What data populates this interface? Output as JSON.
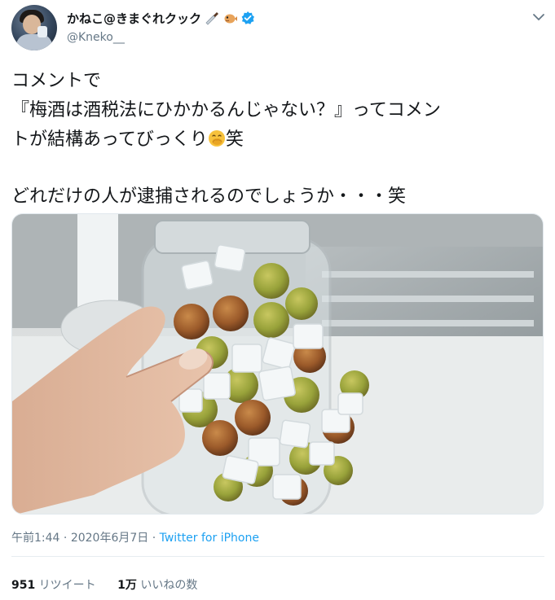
{
  "author": {
    "display_name": "かねこ@きまぐれクック",
    "handle": "@Kneko__",
    "name_emojis": [
      "kitchen-knife-icon",
      "blowfish-icon"
    ],
    "verified": true
  },
  "tweet": {
    "lines": [
      "コメントで",
      "『梅酒は酒税法にひかかるんじゃない？』ってコメン",
      "トが結構あってびっくり",
      "笑",
      "どれだけの人が逮捕されるのでしょうか・・・笑"
    ],
    "emoji": "face-with-hand-over-mouth-icon"
  },
  "photo": {
    "description_icon": "plum-wine-jar-photo"
  },
  "meta": {
    "time": "午前1:44",
    "separator": "·",
    "date": "2020年6月7日",
    "source": "Twitter for iPhone"
  },
  "stats": {
    "retweets_count": "951",
    "retweets_label": "リツイート",
    "likes_count": "1万",
    "likes_label": "いいねの数"
  },
  "colors": {
    "accent": "#1da1f2",
    "text": "#14171a",
    "secondary": "#657786",
    "border": "#e6ecf0"
  }
}
